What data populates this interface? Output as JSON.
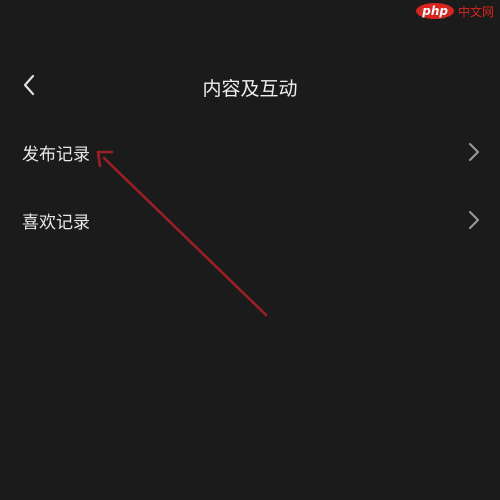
{
  "watermark": {
    "logo_text": "php",
    "site_text": "中文网",
    "color": "#d9251d"
  },
  "header": {
    "back_icon": "chevron-left-icon",
    "title": "内容及互动"
  },
  "menu": {
    "items": [
      {
        "label": "发布记录",
        "icon": "chevron-right-icon"
      },
      {
        "label": "喜欢记录",
        "icon": "chevron-right-icon"
      }
    ]
  },
  "annotation": {
    "type": "arrow",
    "color": "#9b1f24",
    "points_to": "发布记录"
  },
  "colors": {
    "background": "#1b1b1b",
    "text": "#e8e8e8",
    "chevron": "#9a9a9a"
  }
}
